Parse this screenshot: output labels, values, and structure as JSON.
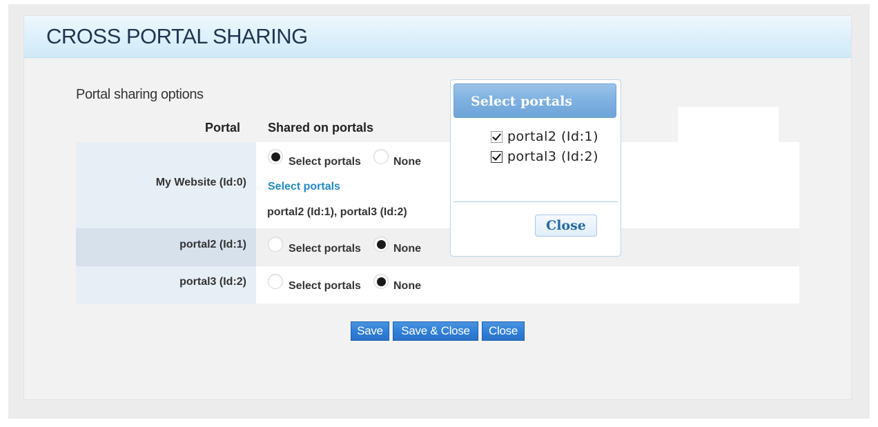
{
  "panel": {
    "title": "CROSS PORTAL SHARING"
  },
  "section": {
    "label": "Portal sharing options"
  },
  "table": {
    "headers": {
      "portal": "Portal",
      "shared": "Shared on portals"
    },
    "rows": [
      {
        "portal": "My Website (Id:0)",
        "select_label": "Select portals",
        "none_label": "None",
        "selected": "select",
        "link": "Select portals",
        "shared_list": "portal2 (Id:1), portal3 (Id:2)"
      },
      {
        "portal": "portal2 (Id:1)",
        "select_label": "Select portals",
        "none_label": "None",
        "selected": "none"
      },
      {
        "portal": "portal3 (Id:2)",
        "select_label": "Select portals",
        "none_label": "None",
        "selected": "none"
      }
    ]
  },
  "buttons": {
    "save": "Save",
    "save_close": "Save & Close",
    "close": "Close"
  },
  "popup": {
    "title": "Select portals",
    "items": [
      {
        "label": "portal2 (Id:1)",
        "checked": true
      },
      {
        "label": "portal3 (Id:2)",
        "checked": true
      }
    ],
    "close": "Close"
  },
  "colors": {
    "header_bg": "#dcf0fb",
    "title_text": "#1f3550",
    "button_blue": "#2f7ed8",
    "link_blue": "#1f8ac3",
    "popup_header": "#80b2e1"
  }
}
